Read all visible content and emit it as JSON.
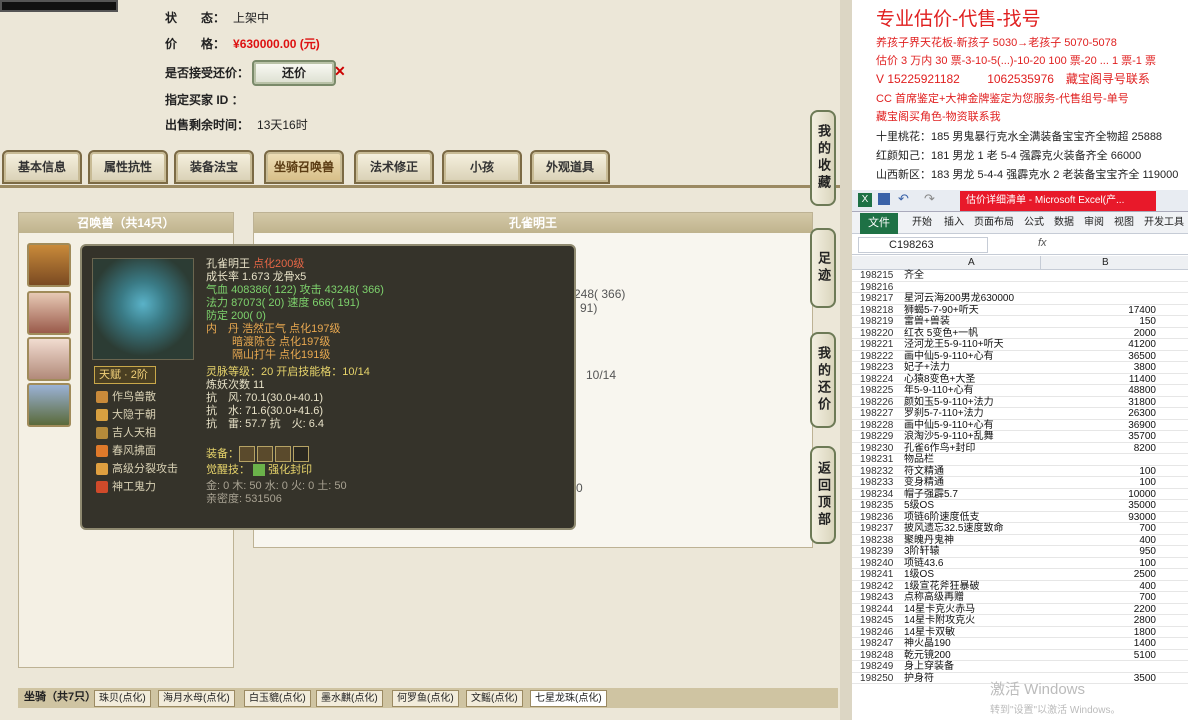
{
  "listing": {
    "status_label": "状　　态：",
    "status_value": "上架中",
    "price_label": "价　　格：",
    "price_value": "¥630000.00 (元)",
    "accept_haggle_label": "是否接受还价：",
    "haggle_button": "还价",
    "buyer_id_label": "指定买家 ID ：",
    "time_left_label": "出售剩余时间：",
    "time_left_value": "13天16时"
  },
  "tabs": [
    "基本信息",
    "属性抗性",
    "装备法宝",
    "坐骑召唤兽",
    "法术修正",
    "小孩",
    "外观道具"
  ],
  "active_tab": "坐骑召唤兽",
  "summon_panel": {
    "header": "召唤兽（共14只）"
  },
  "main_panel": {
    "header": "孔雀明王",
    "partial_1": "248( 366)",
    "partial_2": "91)",
    "partial_3": "10/14",
    "partial_4": "0"
  },
  "tooltip": {
    "name": "孔雀明王",
    "name_suffix": "点化200级",
    "growth": "成长率 1.673 龙骨x5",
    "hp_label": "气血",
    "hp": "408386( 122)",
    "atk_label": "攻击",
    "atk": "43248( 366)",
    "mp_label": "法力",
    "mp": "87073( 20)",
    "spd_label": "速度",
    "spd": "666( 191)",
    "def": "防定 200( 0)",
    "neidan_label": "内　丹",
    "neidan1": "浩然正气 点化197级",
    "neidan2": "暗渡陈仓 点化197级",
    "neidan3": "隔山打牛 点化191级",
    "rank": "天赋 · 2阶",
    "spirit": "灵脉等级：20 开启技能格：10/14",
    "refine": "炼妖次数 11",
    "res1": "抗　风: 70.1(30.0+40.1)",
    "res2": "抗　水: 71.6(30.0+41.6)",
    "res3": "抗　雷: 57.7 抗　火: 6.4",
    "equip_label": "装备：",
    "awaken_label": "觉醒技：",
    "awaken": "强化封印",
    "elements": "金: 0 木: 50 水: 0 火: 0 土: 50",
    "intimacy": "亲密度: 531506",
    "skills": [
      "作鸟兽散",
      "大隐于朝",
      "吉人天相",
      "春风拂面",
      "高级分裂攻击",
      "神工鬼力"
    ]
  },
  "side_buttons": [
    "我的收藏",
    "足迹",
    "我的还价",
    "返回顶部"
  ],
  "bottom_tabs": [
    "坐骑（共7只）",
    "珠贝(点化)",
    "海月水母(点化)",
    "白玉貔(点化)",
    "墨水麒(点化)",
    "何罗鱼(点化)",
    "文鳐(点化)",
    "七星龙珠(点化)"
  ],
  "ad": {
    "title": "专业估价-代售-找号",
    "l1": "养孩子界天花板-新孩子 5030→老孩子 5070-5078",
    "l2": "估价 3 万内 30 票-3-10-5(...)-10-20 100 票-20 ... 1 票-1 票",
    "l3": "V 15225921182　　 1062535976　藏宝阁寻号联系",
    "l4": "CC 首席鉴定+大神金牌鉴定为您服务-代售组号-单号",
    "l5": "藏宝阁买角色-物资联系我",
    "l6": "十里桃花：185 男鬼暴行克水全满装备宝宝齐全物超 25888",
    "l7": "红颜知己：181 男龙 1 老 5-4 强霹克火装备齐全 66000",
    "l8": "山西新区：183 男龙 5-4-4 强霹克水 2 老装备宝宝齐全 119000"
  },
  "excel": {
    "window_title": "估价详细清单 - Microsoft Excel(产...",
    "ribbon": [
      "文件",
      "开始",
      "插入",
      "页面布局",
      "公式",
      "数据",
      "审阅",
      "视图",
      "开发工具"
    ],
    "name_box": "C198263",
    "fx": "fx",
    "col_a": "A",
    "col_b": "B",
    "rows": [
      [
        "198215",
        "齐全",
        ""
      ],
      [
        "198216",
        "",
        ""
      ],
      [
        "198217",
        "星河云海200男龙630000",
        ""
      ],
      [
        "198218",
        "狮蝎5-7-90+听天",
        "17400"
      ],
      [
        "198219",
        "雷兽+兽装",
        "150"
      ],
      [
        "198220",
        "红衣 5变色+一帆",
        "2000"
      ],
      [
        "198221",
        "泾河龙王5-9-110+听天",
        "41200"
      ],
      [
        "198222",
        "画中仙5-9-110+心有",
        "36500"
      ],
      [
        "198223",
        "妃子+法力",
        "3800"
      ],
      [
        "198224",
        "心猿8变色+大圣",
        "11400"
      ],
      [
        "198225",
        "年5-9-110+心有",
        "48800"
      ],
      [
        "198226",
        "颜如玉5-9-110+法力",
        "31800"
      ],
      [
        "198227",
        "罗刹5-7-110+法力",
        "26300"
      ],
      [
        "198228",
        "画中仙5-9-110+心有",
        "36900"
      ],
      [
        "198229",
        "浪淘沙5-9-110+乱舞",
        "35700"
      ],
      [
        "198230",
        "孔雀6作鸟+封印",
        "8200"
      ],
      [
        "198231",
        "物品栏",
        ""
      ],
      [
        "198232",
        "符文精通",
        "100"
      ],
      [
        "198233",
        "变身精通",
        "100"
      ],
      [
        "198234",
        "帽子强霹5.7",
        "10000"
      ],
      [
        "198235",
        "5级OS",
        "35000"
      ],
      [
        "198236",
        "项链6阶速度低支",
        "93000"
      ],
      [
        "198237",
        "披风遗忘32.5速度致命",
        "700"
      ],
      [
        "198238",
        "聚魄丹鬼神",
        "400"
      ],
      [
        "198239",
        "3阶轩辕",
        "950"
      ],
      [
        "198240",
        "项链43.6",
        "100"
      ],
      [
        "198241",
        "1级OS",
        "2500"
      ],
      [
        "198242",
        "1级宣花斧狂暴破",
        "400"
      ],
      [
        "198243",
        "点称高级再赠",
        "700"
      ],
      [
        "198244",
        "14星卡克火赤马",
        "2200"
      ],
      [
        "198245",
        "14星卡附攻克火",
        "2800"
      ],
      [
        "198246",
        "14星卡双敏",
        "1800"
      ],
      [
        "198247",
        "神火晶190",
        "1400"
      ],
      [
        "198248",
        "乾元镜200",
        "5100"
      ],
      [
        "198249",
        "身上穿装备",
        ""
      ],
      [
        "198250",
        "护身符",
        "3500"
      ]
    ],
    "watermark": "激活 Windows",
    "watermark2": "转到\"设置\"以激活 Windows。"
  },
  "colors": {
    "accent_red": "#e02020",
    "excel_green": "#1e7145",
    "tooltip_bg": "#35332a"
  }
}
